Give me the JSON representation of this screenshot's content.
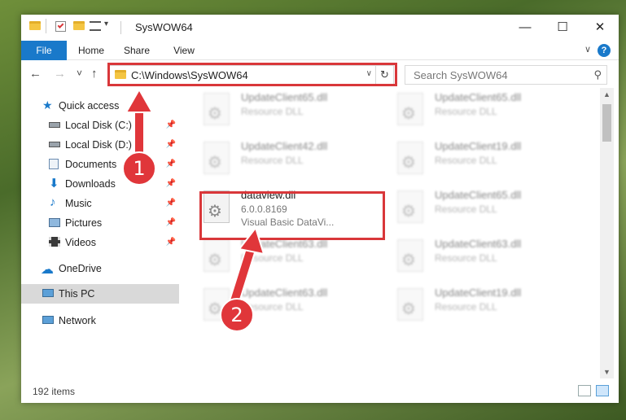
{
  "window": {
    "title": "SysWOW64",
    "minimize_glyph": "—",
    "maximize_glyph": "☐",
    "close_glyph": "✕"
  },
  "ribbon": {
    "tabs": [
      "File",
      "Home",
      "Share",
      "View"
    ],
    "help_glyph": "?",
    "expand_glyph": "∨"
  },
  "navigation": {
    "back_glyph": "←",
    "forward_glyph": "→",
    "recent_glyph": "˅",
    "up_glyph": "↑",
    "address": "C:\\Windows\\SysWOW64",
    "address_dropdown_glyph": "∨",
    "refresh_glyph": "↻",
    "search_placeholder": "Search SysWOW64",
    "search_glyph": "⚲"
  },
  "sidebar": {
    "quick_access": "Quick access",
    "items": [
      {
        "label": "Local Disk (C:)",
        "icon": "drive-icon"
      },
      {
        "label": "Local Disk (D:)",
        "icon": "drive-icon"
      },
      {
        "label": "Documents",
        "icon": "documents-icon"
      },
      {
        "label": "Downloads",
        "icon": "downloads-icon"
      },
      {
        "label": "Music",
        "icon": "music-icon"
      },
      {
        "label": "Pictures",
        "icon": "pictures-icon"
      },
      {
        "label": "Videos",
        "icon": "videos-icon"
      }
    ],
    "onedrive": "OneDrive",
    "this_pc": "This PC",
    "network": "Network"
  },
  "files": {
    "selected": {
      "name": "dataview.dll",
      "version": "6.0.0.8169",
      "description": "Visual Basic DataVi..."
    },
    "background": [
      {
        "name": "UpdateClient65.dll",
        "type": "Resource DLL"
      },
      {
        "name": "UpdateClient65.dll",
        "type": "Resource DLL"
      },
      {
        "name": "UpdateClient42.dll",
        "type": "Resource DLL"
      },
      {
        "name": "UpdateClient19.dll",
        "type": "Resource DLL"
      },
      {
        "name": "UpdateClient65.dll",
        "type": "Resource DLL"
      },
      {
        "name": "UpdateClient63.dll",
        "type": "Resource DLL"
      },
      {
        "name": "UpdateClient63.dll",
        "type": "Resource DLL"
      },
      {
        "name": "UpdateClient63.dll",
        "type": "Resource DLL"
      },
      {
        "name": "UpdateClient19.dll",
        "type": "Resource DLL"
      }
    ]
  },
  "status": {
    "item_count": "192 items"
  },
  "annotations": {
    "step1": "1",
    "step2": "2"
  },
  "colors": {
    "accent": "#1979ca",
    "annotation": "#e0363a",
    "highlight": "#d9373a",
    "folder": "#f4c542"
  }
}
